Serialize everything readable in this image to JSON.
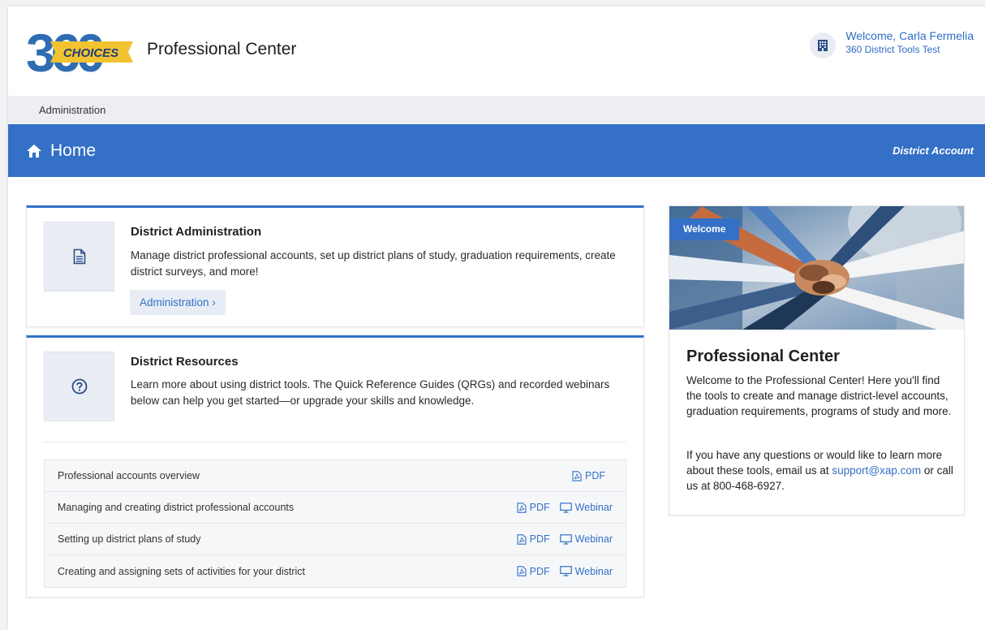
{
  "header": {
    "logo_text": "CHOICES",
    "logo_number": "360",
    "title": "Professional Center",
    "user_welcome": "Welcome, Carla Fermelia",
    "user_district": "360 District Tools Test"
  },
  "admin_bar": {
    "label": "Administration"
  },
  "home_bar": {
    "title": "Home",
    "account_label": "District Account"
  },
  "district_admin": {
    "heading": "District Administration",
    "description": "Manage district professional accounts, set up district plans of study, graduation requirements, create district surveys, and more!",
    "button_label": "Administration ›"
  },
  "district_resources": {
    "heading": "District Resources",
    "description": "Learn more about using district tools. The Quick Reference Guides (QRGs) and recorded webinars below can help you get started—or upgrade your skills and knowledge.",
    "pdf_label": "PDF",
    "webinar_label": "Webinar",
    "rows": [
      {
        "title": "Professional accounts overview",
        "has_webinar": false
      },
      {
        "title": "Managing and creating district professional accounts",
        "has_webinar": true
      },
      {
        "title": "Setting up district plans of study",
        "has_webinar": true
      },
      {
        "title": "Creating and assigning sets of activities for your district",
        "has_webinar": true
      }
    ]
  },
  "sidebar": {
    "badge": "Welcome",
    "title": "Professional Center",
    "intro": "Welcome to the Professional Center! Here you'll find the tools to create and manage district-level accounts, graduation requirements, programs of study and more.",
    "contact_prefix": "If you have any questions or would like to learn more about these tools, email us at",
    "email": "support@xap.com",
    "contact_suffix": "or call us at 800-468-6927."
  },
  "colors": {
    "accent": "#3470c6",
    "logo_yellow": "#f2c230",
    "logo_blue": "#2f6db3"
  }
}
